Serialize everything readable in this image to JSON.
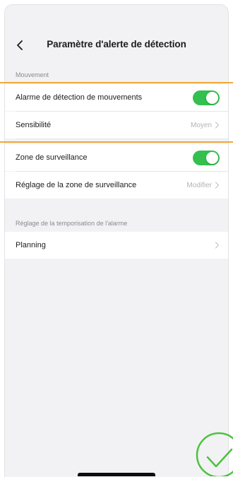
{
  "header": {
    "title": "Paramètre d'alerte de détection"
  },
  "sections": [
    {
      "label": "Mouvement",
      "rows": [
        {
          "label": "Alarme de détection de mouvements",
          "type": "toggle",
          "on": true
        },
        {
          "label": "Sensibilité",
          "type": "value",
          "value": "Moyen"
        },
        {
          "label": "Zone de surveillance",
          "type": "toggle",
          "on": true
        },
        {
          "label": "Réglage de la zone de surveillance",
          "type": "value",
          "value": "Modifier"
        }
      ]
    },
    {
      "label": "Réglage de la temporisation de l'alarme",
      "rows": [
        {
          "label": "Planning",
          "type": "chevron"
        }
      ]
    }
  ],
  "colors": {
    "toggle_on": "#33c04f",
    "highlight": "#f0a83a",
    "check_badge": "#4cc23f"
  },
  "icons": {
    "back": "chevron-left-icon",
    "row_arrow": "chevron-right-icon",
    "badge": "checkmark-circle-icon"
  }
}
